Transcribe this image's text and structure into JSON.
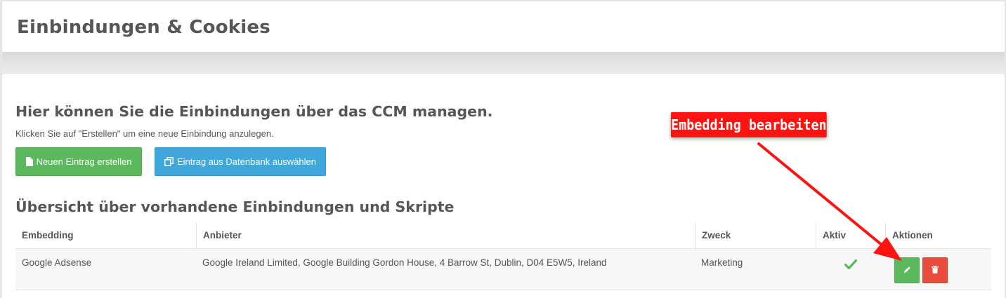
{
  "header": {
    "title": "Einbindungen & Cookies"
  },
  "main": {
    "heading": "Hier können Sie die Einbindungen über das CCM managen.",
    "help_text": "Klicken Sie auf \"Erstellen\" um eine neue Einbindung anzulegen.",
    "buttons": {
      "create": {
        "label": "Neuen Eintrag erstellen",
        "icon": "file-icon"
      },
      "from_db": {
        "label": "Eintrag aus Datenbank auswählen",
        "icon": "copy-icon"
      }
    },
    "overview_heading": "Übersicht über vorhandene Einbindungen und Skripte"
  },
  "table": {
    "columns": [
      "Embedding",
      "Anbieter",
      "Zweck",
      "Aktiv",
      "Aktionen"
    ],
    "rows": [
      {
        "embedding": "Google Adsense",
        "provider": "Google Ireland Limited, Google Building Gordon House, 4 Barrow St, Dublin, D04 E5W5, Ireland",
        "purpose": "Marketing",
        "active": true,
        "actions": [
          "pencil-icon",
          "trash-icon"
        ]
      }
    ]
  },
  "annotation": {
    "label": "Embedding bearbeiten"
  },
  "colors": {
    "success": "#5cb85c",
    "info": "#3ea8dc",
    "danger": "#e94b3c",
    "annotation": "#ff1212",
    "check": "#5cb85c"
  }
}
